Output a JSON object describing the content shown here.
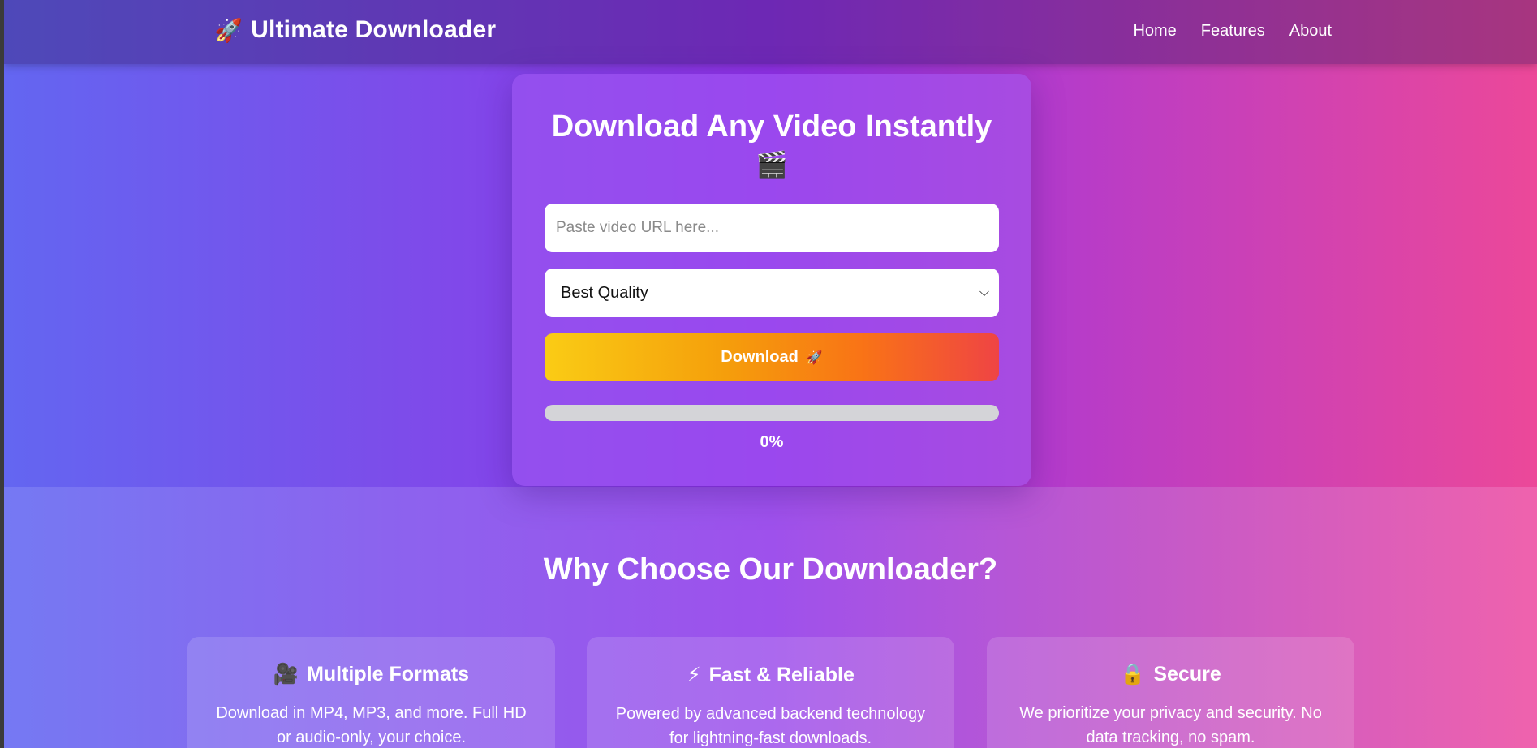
{
  "header": {
    "brand_icon": "🚀",
    "brand_name": "Ultimate Downloader",
    "nav": [
      "Home",
      "Features",
      "About"
    ]
  },
  "card": {
    "title": "Download Any Video Instantly",
    "title_icon": "🎬",
    "url_placeholder": "Paste video URL here...",
    "quality_selected": "Best Quality",
    "download_label": "Download",
    "download_icon": "🚀",
    "progress_percent": 0,
    "progress_text": "0%"
  },
  "features": {
    "title": "Why Choose Our Downloader?",
    "items": [
      {
        "icon": "🎥",
        "title": "Multiple Formats",
        "text": "Download in MP4, MP3, and more. Full HD or audio-only, your choice."
      },
      {
        "icon": "⚡",
        "title": "Fast & Reliable",
        "text": "Powered by advanced backend technology for lightning-fast downloads."
      },
      {
        "icon": "🔒",
        "title": "Secure",
        "text": "We prioritize your privacy and security. No data tracking, no spam."
      }
    ]
  },
  "colors": {
    "gradient_start": "#6366f1",
    "gradient_mid": "#9333ea",
    "gradient_end": "#ec4899",
    "button_start": "#facc15",
    "button_end": "#ef4444"
  }
}
